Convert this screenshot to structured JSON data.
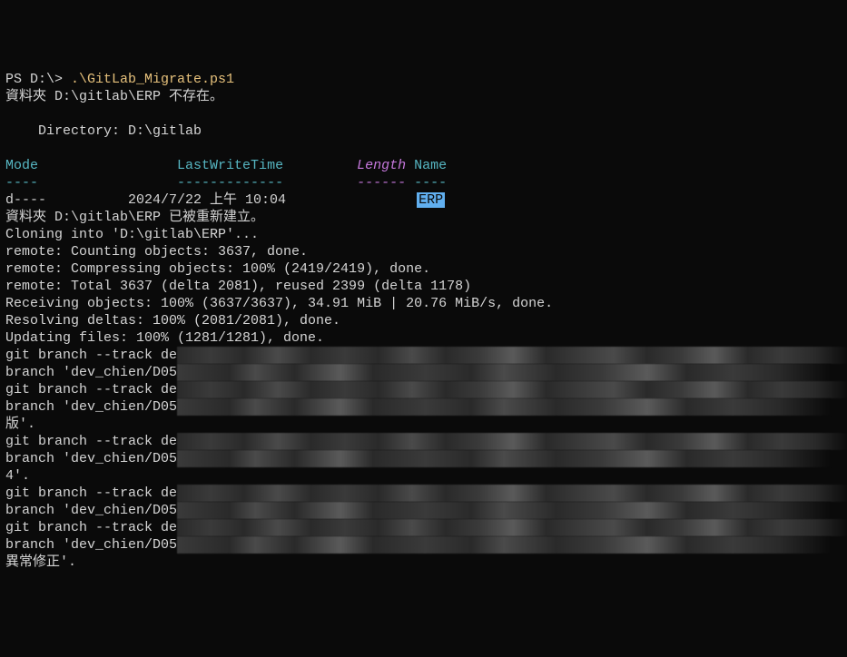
{
  "prompt": "PS D:\\> ",
  "command": ".\\GitLab_Migrate.ps1",
  "msg_not_exist": "資料夾 D:\\gitlab\\ERP 不存在。",
  "directory_line": "    Directory: D:\\gitlab",
  "headers": {
    "mode": "Mode",
    "lwt": "LastWriteTime",
    "length": "Length",
    "name": "Name"
  },
  "separators": {
    "mode": "----",
    "lwt": "-------------",
    "length": "------",
    "name": "----"
  },
  "row": {
    "mode": "d----",
    "date": "2024/7/22 上午 10:04",
    "name": "ERP"
  },
  "msg_recreated": "資料夾 D:\\gitlab\\ERP 已被重新建立。",
  "clone1": "Cloning into 'D:\\gitlab\\ERP'...",
  "clone2": "remote: Counting objects: 3637, done.",
  "clone3": "remote: Compressing objects: 100% (2419/2419), done.",
  "clone4": "remote: Total 3637 (delta 2081), reused 2399 (delta 1178)",
  "clone5": "Receiving objects: 100% (3637/3637), 34.91 MiB | 20.76 MiB/s, done.",
  "clone6": "Resolving deltas: 100% (2081/2081), done.",
  "clone7": "Updating files: 100% (1281/1281), done.",
  "branch_prefix1": "git branch --track de",
  "branch_prefix2": "branch 'dev_chien/D05",
  "wrap1": "版'.",
  "wrap2": "4'.",
  "wrap3": "異常修正'."
}
